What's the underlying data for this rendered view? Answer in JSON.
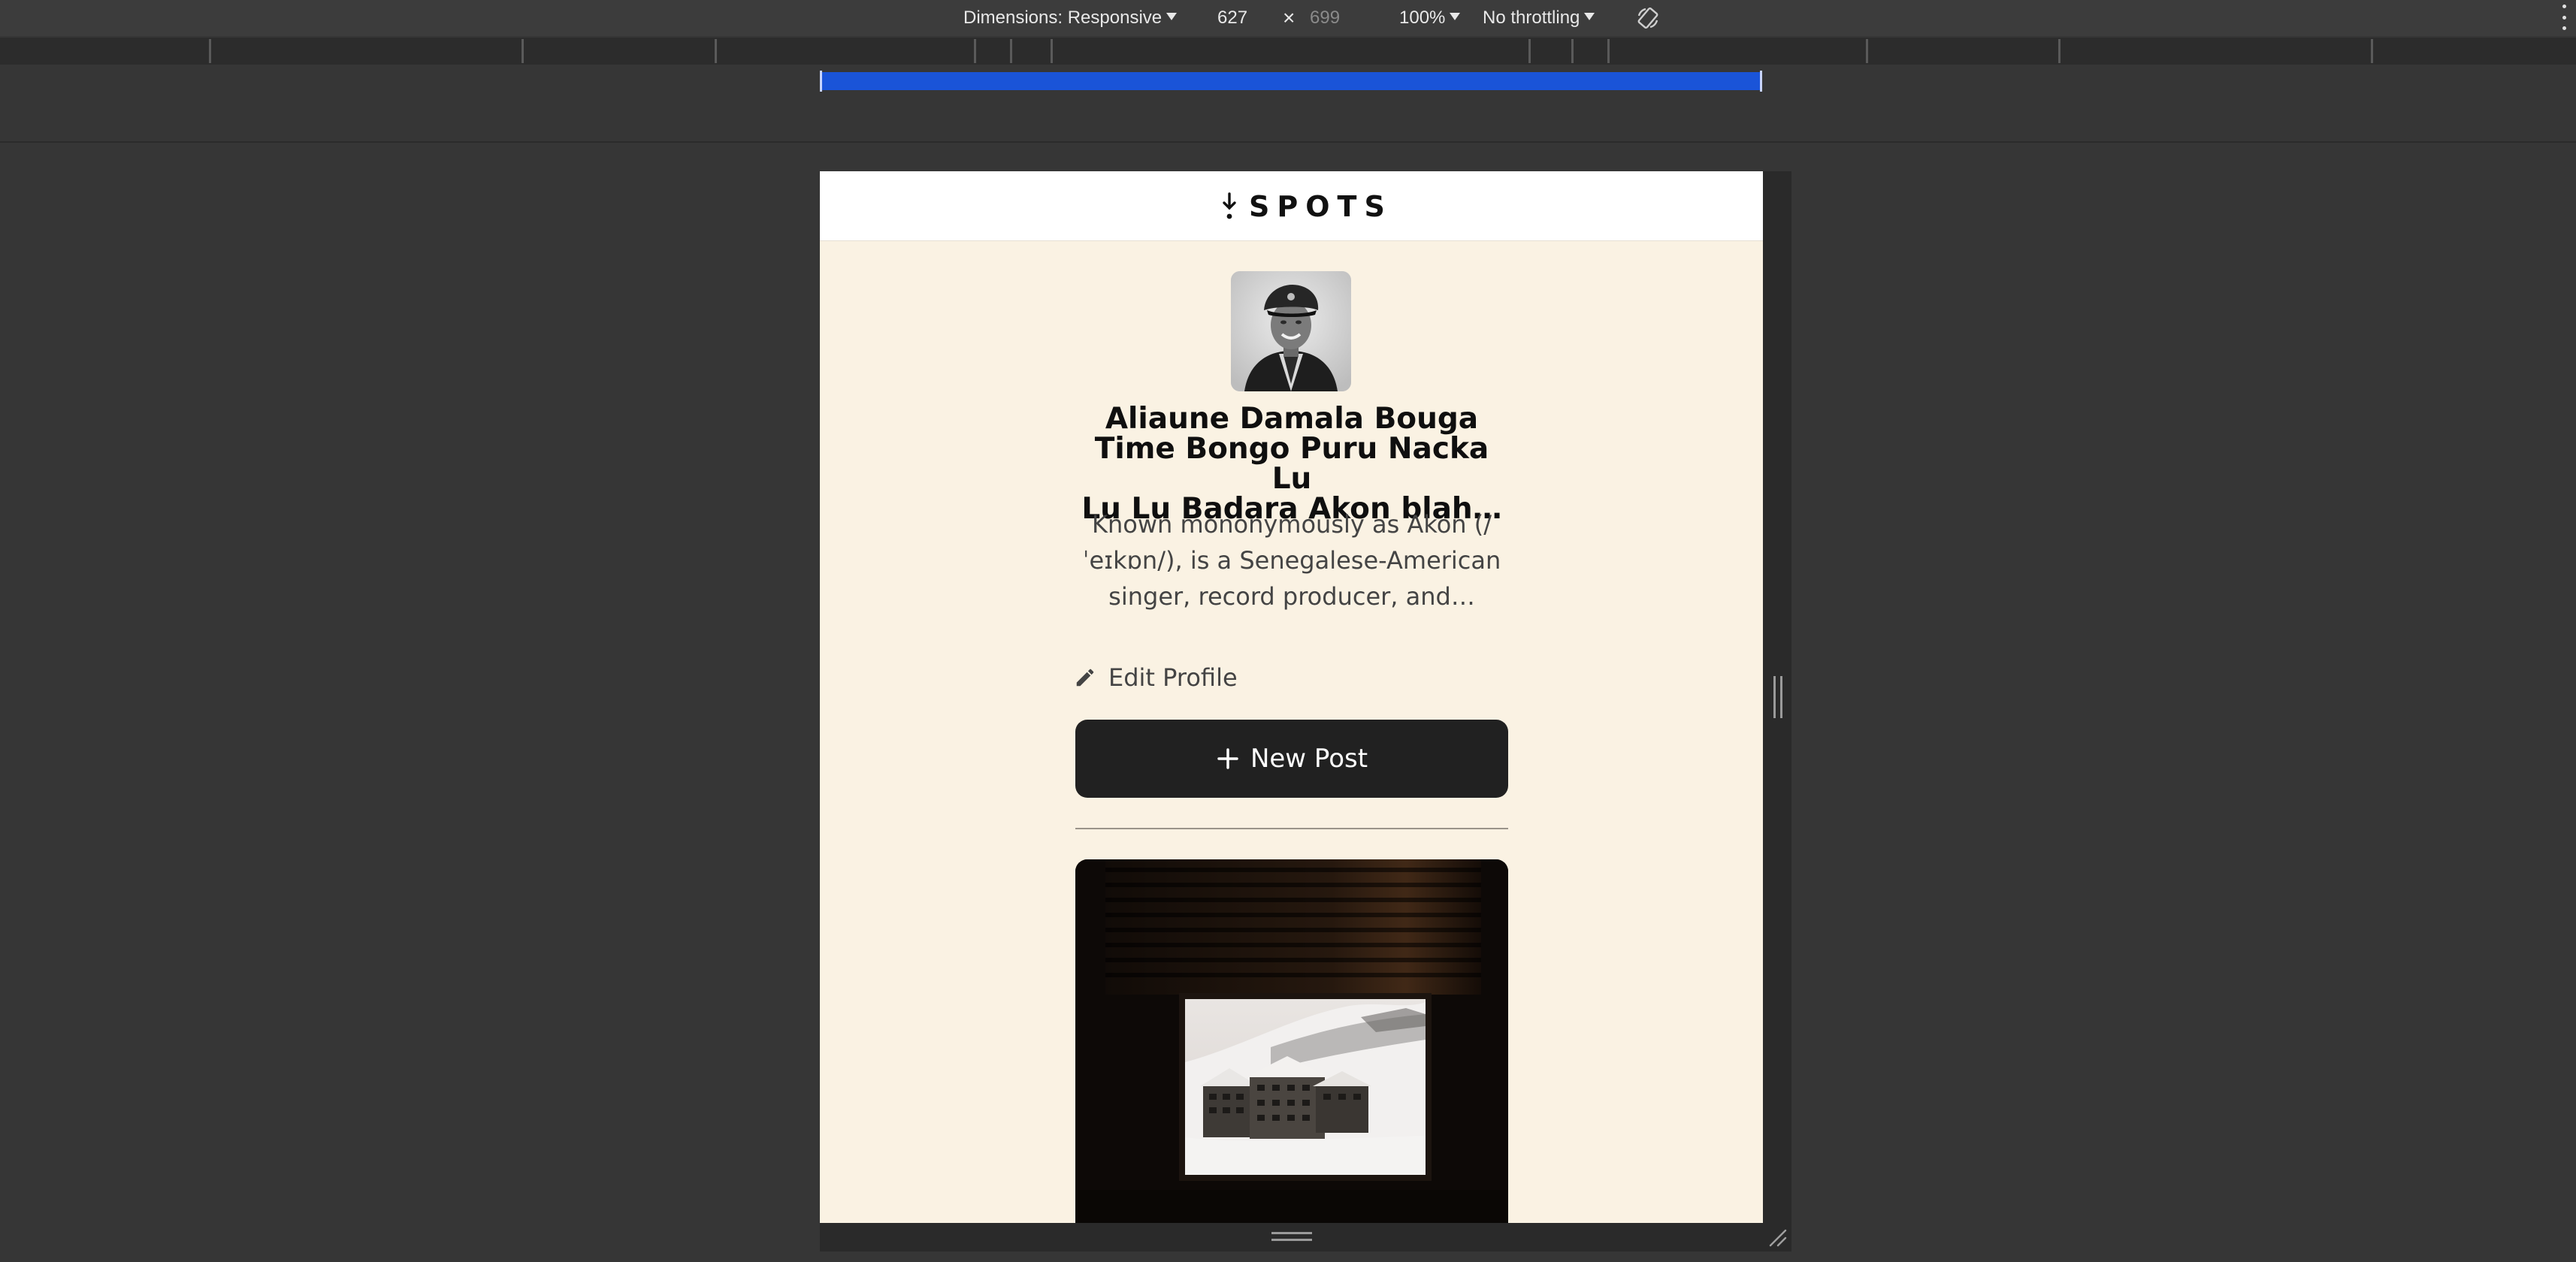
{
  "devtools": {
    "dimensions_label": "Dimensions: Responsive",
    "width_value": "627",
    "times_sign": "×",
    "height_placeholder": "699",
    "zoom": "100%",
    "throttling": "No throttling",
    "rotate_icon": "rotate-icon",
    "more_icon": "kebab-menu-icon",
    "accent_color": "#1a54d8"
  },
  "site": {
    "logo_text": "SPOTS",
    "logo_icon": "arrow-down-icon"
  },
  "profile": {
    "name": "Aliaune Damala Bouga Time Bongo Puru Nacka Lu Lu Lu Badara Akon blah…",
    "name_lines": [
      "Aliaune Damala Bouga",
      "Time Bongo Puru Nacka Lu",
      "Lu Lu Badara Akon blah…"
    ],
    "description_lines": [
      "Known mononymously as Akon (/",
      "ˈeɪkɒn/), is a Senegalese-American",
      "singer, record producer, and…"
    ],
    "edit_label": "Edit Profile",
    "edit_icon": "pencil-icon"
  },
  "actions": {
    "new_post_label": "New Post",
    "new_post_icon": "plus-icon"
  }
}
